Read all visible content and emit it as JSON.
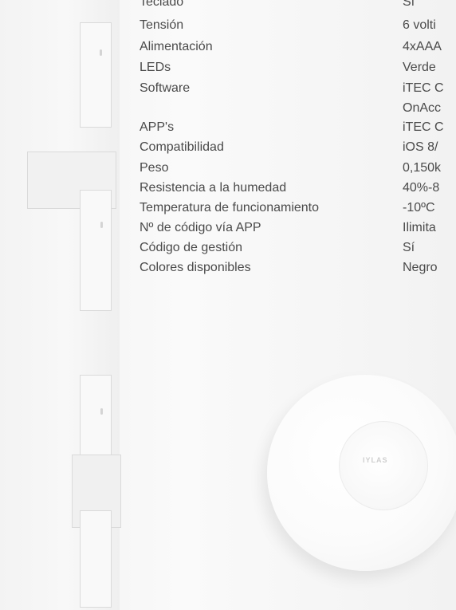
{
  "specs": [
    {
      "label": "Teclado",
      "value": "Sí"
    },
    {
      "label": "Tensión",
      "value": "6 volti"
    },
    {
      "label": "Alimentación",
      "value": "4xAAA"
    },
    {
      "label": "LEDs",
      "value": "Verde"
    },
    {
      "label": "Software",
      "value": "iTEC C"
    },
    {
      "label": "",
      "value": "OnAcc"
    },
    {
      "label": "APP's",
      "value": "iTEC C"
    },
    {
      "label": "Compatibilidad",
      "value": "iOS 8/"
    },
    {
      "label": "Peso",
      "value": "0,150k"
    },
    {
      "label": "Resistencia a la humedad",
      "value": "40%-8"
    },
    {
      "label": "Temperatura de funcionamiento",
      "value": "-10ºC"
    },
    {
      "label": "Nº de código vía APP",
      "value": "Ilimita"
    },
    {
      "label": "Código de gestión",
      "value": "Sí"
    },
    {
      "label": "Colores disponibles",
      "value": "Negro"
    }
  ],
  "device": {
    "logo_text": "IYLAS"
  }
}
